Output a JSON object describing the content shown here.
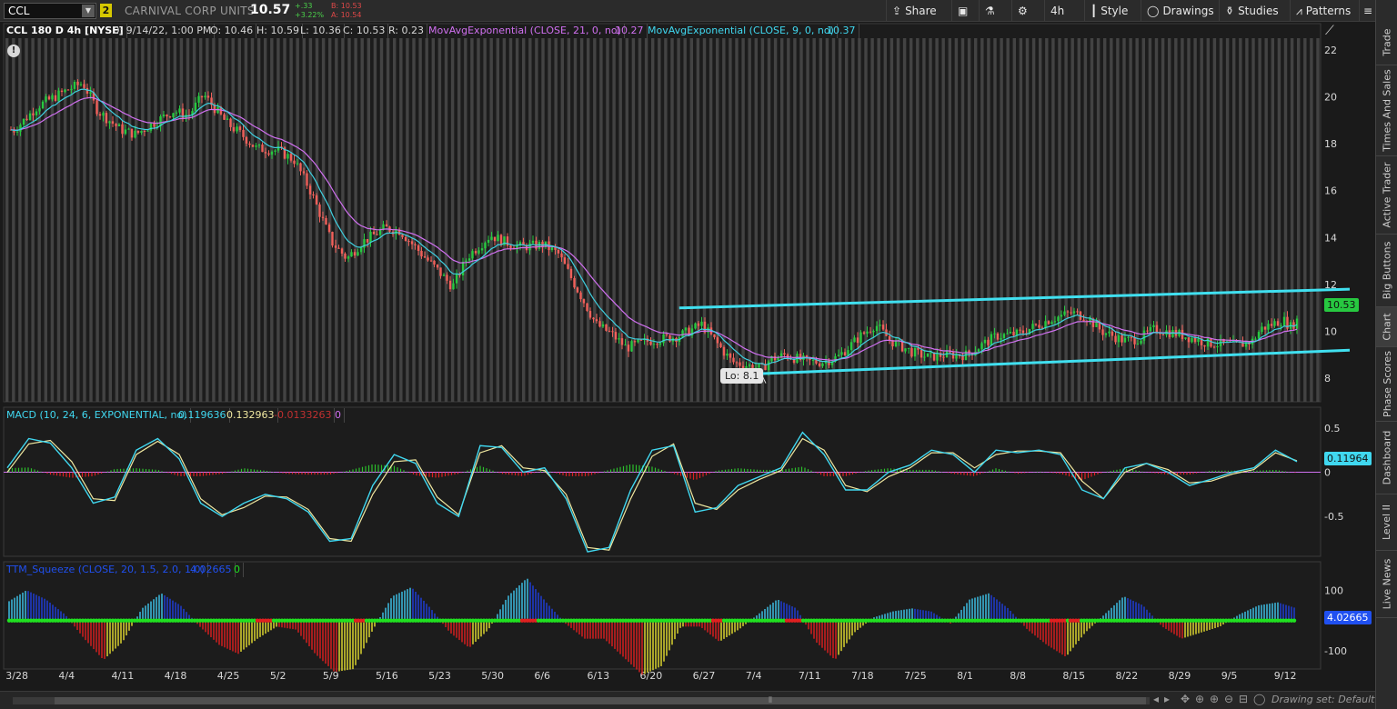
{
  "toolbar": {
    "symbol": "CCL",
    "link_badge": "2",
    "company": "CARNIVAL CORP UNITS",
    "last": "10.57",
    "change_abs": "+.33",
    "change_pct": "+3.22%",
    "bid": "B: 10.53",
    "ask": "A: 10.54",
    "share": "Share",
    "aggregation": "4h",
    "style": "Style",
    "drawings": "Drawings",
    "studies": "Studies",
    "patterns": "Patterns"
  },
  "right_tabs": [
    "Trade",
    "Times And Sales",
    "Active Trader",
    "Big Buttons",
    "Chart",
    "Phase Scores",
    "Dashboard",
    "Level II",
    "Live News"
  ],
  "active_tab": "Chart",
  "price_header": {
    "title": "CCL 180 D 4h [NYSE]",
    "date": "D: 9/14/22, 1:00 PM",
    "open": "O: 10.46",
    "high": "H: 10.59",
    "low": "L: 10.36",
    "close": "C: 10.53",
    "range": "R: 0.23",
    "ema21_label": "MovAvgExponential (CLOSE, 21, 0, no)",
    "ema21_value": "10.27",
    "ema9_label": "MovAvgExponential (CLOSE, 9, 0, no)",
    "ema9_value": "10.37"
  },
  "macd_header": {
    "label": "MACD (10, 24, 6, EXPONENTIAL, no)",
    "value": "0.119636",
    "avg": "0.132963",
    "diff": "-0.0133263",
    "zero": "0"
  },
  "ttm_header": {
    "label": "TTM_Squeeze (CLOSE, 20, 1.5, 2.0, 1.0)",
    "value": "4.02665",
    "zero": "0"
  },
  "price_tag": "10.53",
  "macd_tag": "0.11964",
  "ttm_tag": "4.02665",
  "lo_label": "Lo: 8.1",
  "drawing_set": "Drawing set: Default",
  "colors": {
    "up": "#27c840",
    "down": "#f0605a",
    "ema9": "#3fd0e0",
    "ema21": "#d070f0",
    "trendline": "#40e0f0",
    "macd": "#40d8f0",
    "macd_avg": "#f0e8a0",
    "squeeze_on": "#e02020",
    "squeeze_off": "#20e020"
  },
  "chart_data": [
    {
      "type": "candlestick",
      "symbol": "CCL",
      "aggregation": "4h",
      "ylim": [
        7,
        22.5
      ],
      "y_ticks": [
        8,
        10,
        12,
        14,
        16,
        18,
        20,
        22
      ],
      "x_ticks": [
        "3/28",
        "4/4",
        "4/11",
        "4/18",
        "4/25",
        "5/2",
        "5/9",
        "5/16",
        "5/23",
        "5/30",
        "6/6",
        "6/13",
        "6/20",
        "6/27",
        "7/4",
        "7/11",
        "7/18",
        "7/25",
        "8/1",
        "8/8",
        "8/15",
        "8/22",
        "8/29",
        "9/5",
        "9/12"
      ],
      "close_path": [
        {
          "date": "3/28",
          "close": 18.6
        },
        {
          "date": "3/31",
          "close": 19.6
        },
        {
          "date": "4/4",
          "close": 20.3
        },
        {
          "date": "4/6",
          "close": 20.6
        },
        {
          "date": "4/8",
          "close": 19.4
        },
        {
          "date": "4/11",
          "close": 18.6
        },
        {
          "date": "4/13",
          "close": 18.4
        },
        {
          "date": "4/15",
          "close": 18.8
        },
        {
          "date": "4/18",
          "close": 19.4
        },
        {
          "date": "4/20",
          "close": 19.2
        },
        {
          "date": "4/22",
          "close": 20.1
        },
        {
          "date": "4/25",
          "close": 18.9
        },
        {
          "date": "4/27",
          "close": 18.4
        },
        {
          "date": "4/29",
          "close": 17.8
        },
        {
          "date": "5/2",
          "close": 17.7
        },
        {
          "date": "5/4",
          "close": 17.3
        },
        {
          "date": "5/6",
          "close": 16.1
        },
        {
          "date": "5/9",
          "close": 13.8
        },
        {
          "date": "5/11",
          "close": 13.1
        },
        {
          "date": "5/13",
          "close": 13.8
        },
        {
          "date": "5/16",
          "close": 14.4
        },
        {
          "date": "5/18",
          "close": 14.3
        },
        {
          "date": "5/20",
          "close": 13.6
        },
        {
          "date": "5/23",
          "close": 12.6
        },
        {
          "date": "5/25",
          "close": 11.9
        },
        {
          "date": "5/27",
          "close": 13.2
        },
        {
          "date": "5/30",
          "close": 14.1
        },
        {
          "date": "6/1",
          "close": 13.8
        },
        {
          "date": "6/3",
          "close": 13.6
        },
        {
          "date": "6/6",
          "close": 13.7
        },
        {
          "date": "6/8",
          "close": 13.3
        },
        {
          "date": "6/10",
          "close": 12.1
        },
        {
          "date": "6/13",
          "close": 10.3
        },
        {
          "date": "6/15",
          "close": 9.9
        },
        {
          "date": "6/17",
          "close": 9.3
        },
        {
          "date": "6/20",
          "close": 9.6
        },
        {
          "date": "6/22",
          "close": 9.7
        },
        {
          "date": "6/24",
          "close": 9.8
        },
        {
          "date": "6/27",
          "close": 10.3
        },
        {
          "date": "6/29",
          "close": 9.5
        },
        {
          "date": "7/1",
          "close": 8.7
        },
        {
          "date": "7/5",
          "close": 8.4
        },
        {
          "date": "7/6",
          "close": 8.8
        },
        {
          "date": "7/8",
          "close": 9.0
        },
        {
          "date": "7/11",
          "close": 8.7
        },
        {
          "date": "7/13",
          "close": 8.7
        },
        {
          "date": "7/15",
          "close": 8.9
        },
        {
          "date": "7/18",
          "close": 9.8
        },
        {
          "date": "7/20",
          "close": 10.3
        },
        {
          "date": "7/22",
          "close": 9.6
        },
        {
          "date": "7/25",
          "close": 9.1
        },
        {
          "date": "7/27",
          "close": 8.9
        },
        {
          "date": "7/29",
          "close": 9.0
        },
        {
          "date": "8/1",
          "close": 9.0
        },
        {
          "date": "8/3",
          "close": 9.4
        },
        {
          "date": "8/5",
          "close": 9.8
        },
        {
          "date": "8/8",
          "close": 9.9
        },
        {
          "date": "8/10",
          "close": 10.2
        },
        {
          "date": "8/12",
          "close": 10.5
        },
        {
          "date": "8/15",
          "close": 10.8
        },
        {
          "date": "8/17",
          "close": 10.6
        },
        {
          "date": "8/19",
          "close": 10.0
        },
        {
          "date": "8/22",
          "close": 9.6
        },
        {
          "date": "8/24",
          "close": 9.7
        },
        {
          "date": "8/26",
          "close": 10.1
        },
        {
          "date": "8/29",
          "close": 9.9
        },
        {
          "date": "8/31",
          "close": 9.7
        },
        {
          "date": "9/2",
          "close": 9.5
        },
        {
          "date": "9/6",
          "close": 9.4
        },
        {
          "date": "9/8",
          "close": 9.6
        },
        {
          "date": "9/9",
          "close": 10.1
        },
        {
          "date": "9/12",
          "close": 10.5
        },
        {
          "date": "9/13",
          "close": 10.2
        },
        {
          "date": "9/14",
          "close": 10.53
        }
      ],
      "low_marker": {
        "date": "7/5",
        "value": 8.1
      },
      "trendlines": [
        {
          "name": "upper",
          "from": {
            "date": "6/24",
            "value": 11.0
          },
          "to": {
            "date": "9/16",
            "value": 11.8
          }
        },
        {
          "name": "lower",
          "from": {
            "date": "7/5",
            "value": 8.2
          },
          "to": {
            "date": "9/16",
            "value": 9.2
          }
        }
      ]
    },
    {
      "type": "line",
      "title": "MACD (10, 24, 6, EXPONENTIAL, no)",
      "ylim": [
        -0.95,
        0.55
      ],
      "y_ticks": [
        0.5,
        0,
        -0.5
      ],
      "series": [
        {
          "name": "Value",
          "values": [
            0.05,
            0.38,
            0.33,
            0.05,
            -0.35,
            -0.28,
            0.25,
            0.38,
            0.15,
            -0.35,
            -0.5,
            -0.35,
            -0.25,
            -0.3,
            -0.45,
            -0.78,
            -0.75,
            -0.15,
            0.2,
            0.1,
            -0.35,
            -0.5,
            0.3,
            0.28,
            0.0,
            0.05,
            -0.3,
            -0.9,
            -0.85,
            -0.2,
            0.25,
            0.3,
            -0.45,
            -0.4,
            -0.15,
            -0.05,
            0.05,
            0.45,
            0.2,
            -0.2,
            -0.2,
            0.0,
            0.08,
            0.25,
            0.2,
            0.0,
            0.25,
            0.22,
            0.25,
            0.2,
            -0.2,
            -0.3,
            0.05,
            0.1,
            0.0,
            -0.15,
            -0.08,
            0.0,
            0.05,
            0.25,
            0.12
          ]
        },
        {
          "name": "Avg",
          "values": [
            0.0,
            0.32,
            0.36,
            0.12,
            -0.3,
            -0.32,
            0.2,
            0.35,
            0.2,
            -0.3,
            -0.48,
            -0.4,
            -0.27,
            -0.28,
            -0.42,
            -0.75,
            -0.78,
            -0.25,
            0.12,
            0.14,
            -0.28,
            -0.48,
            0.22,
            0.3,
            0.05,
            0.02,
            -0.25,
            -0.85,
            -0.88,
            -0.3,
            0.18,
            0.32,
            -0.35,
            -0.42,
            -0.2,
            -0.08,
            0.02,
            0.38,
            0.25,
            -0.15,
            -0.22,
            -0.05,
            0.05,
            0.22,
            0.22,
            0.05,
            0.2,
            0.24,
            0.24,
            0.22,
            -0.1,
            -0.3,
            0.0,
            0.1,
            0.03,
            -0.12,
            -0.1,
            -0.02,
            0.03,
            0.22,
            0.13
          ]
        }
      ]
    },
    {
      "type": "bar",
      "title": "TTM_Squeeze (CLOSE, 20, 1.5, 2.0, 1.0)",
      "ylim": [
        -160,
        140
      ],
      "y_ticks": [
        100,
        0,
        -100
      ],
      "values": [
        60,
        100,
        70,
        20,
        -60,
        -130,
        -70,
        40,
        90,
        50,
        -20,
        -80,
        -110,
        -60,
        -20,
        -30,
        -110,
        -170,
        -160,
        -30,
        80,
        110,
        40,
        -40,
        -90,
        -30,
        80,
        140,
        60,
        -10,
        -60,
        -60,
        -120,
        -180,
        -150,
        -20,
        -20,
        -70,
        -30,
        20,
        70,
        40,
        -70,
        -130,
        -40,
        10,
        30,
        40,
        30,
        -10,
        70,
        90,
        40,
        -30,
        -80,
        -120,
        -40,
        20,
        80,
        50,
        -20,
        -60,
        -40,
        -20,
        20,
        50,
        60,
        40
      ]
    }
  ]
}
